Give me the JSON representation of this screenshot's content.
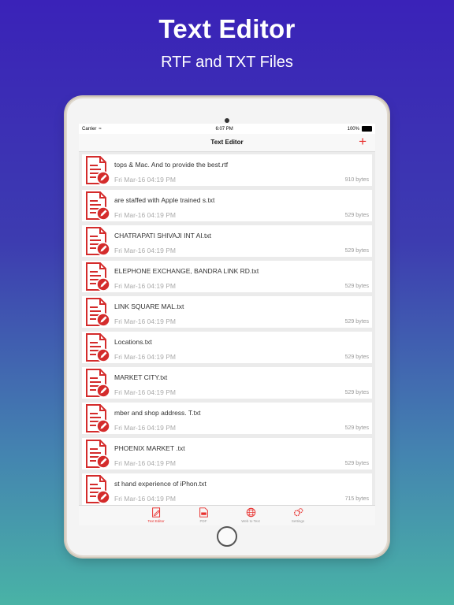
{
  "promo": {
    "title": "Text Editor",
    "subtitle": "RTF and TXT Files"
  },
  "status_bar": {
    "carrier": "Carrier",
    "time": "6:07 PM",
    "battery": "100%"
  },
  "nav": {
    "title": "Text Editor",
    "add_label": "+"
  },
  "files": [
    {
      "name": "tops & Mac. And to provide the best.rtf",
      "date": "Fri Mar-16 04:19 PM",
      "size": "910 bytes"
    },
    {
      "name": "are staffed with Apple trained s.txt",
      "date": "Fri Mar-16 04:19 PM",
      "size": "529 bytes"
    },
    {
      "name": "CHATRAPATI SHIVAJI INT AI.txt",
      "date": "Fri Mar-16 04:19 PM",
      "size": "529 bytes"
    },
    {
      "name": "ELEPHONE EXCHANGE, BANDRA LINK RD.txt",
      "date": "Fri Mar-16 04:19 PM",
      "size": "529 bytes"
    },
    {
      "name": "LINK SQUARE MAL.txt",
      "date": "Fri Mar-16 04:19 PM",
      "size": "529 bytes"
    },
    {
      "name": "Locations.txt",
      "date": "Fri Mar-16 04:19 PM",
      "size": "529 bytes"
    },
    {
      "name": "MARKET CITY.txt",
      "date": "Fri Mar-16 04:19 PM",
      "size": "529 bytes"
    },
    {
      "name": "mber and shop address. T.txt",
      "date": "Fri Mar-16 04:19 PM",
      "size": "529 bytes"
    },
    {
      "name": "PHOENIX MARKET .txt",
      "date": "Fri Mar-16 04:19 PM",
      "size": "529 bytes"
    },
    {
      "name": "st hand experience of iPhon.txt",
      "date": "Fri Mar-16 04:19 PM",
      "size": "715 bytes"
    }
  ],
  "tabs": [
    {
      "label": "Text Editor",
      "icon": "edit-icon",
      "active": true
    },
    {
      "label": "PDF",
      "icon": "pdf-icon",
      "active": false
    },
    {
      "label": "Web to Text",
      "icon": "globe-icon",
      "active": false
    },
    {
      "label": "Settings",
      "icon": "gears-icon",
      "active": false
    }
  ],
  "colors": {
    "accent": "#e8302e",
    "icon_red": "#d42b2b"
  }
}
